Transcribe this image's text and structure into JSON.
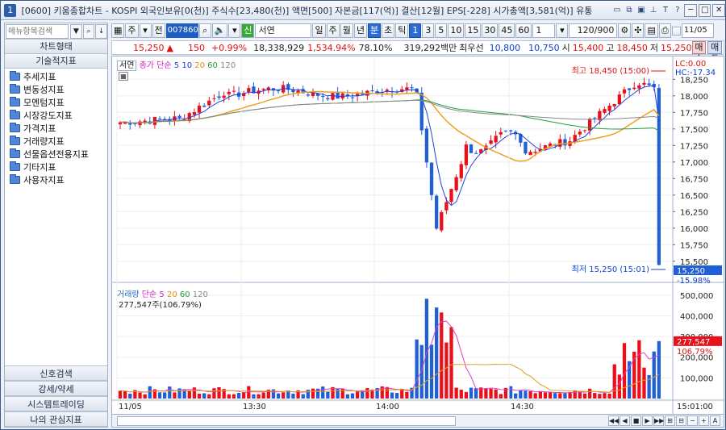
{
  "window": {
    "number": "1",
    "title": "[0600] 키움종합차트 - KOSPI 외국인보유[0(천)] 주식수[23,480(천)] 액면[500] 자본금[117(억)] 결산[12월] EPS[-228] 시가총액[3,581(억)] 유통",
    "tools": [
      "▭",
      "⧉",
      "▣",
      "⊥",
      "T",
      "?"
    ],
    "btn_min": "─",
    "btn_max": "□",
    "btn_close": "✕"
  },
  "left": {
    "search_placeholder": "메뉴항목검색",
    "chart_type_header": "차트형태",
    "tech_header": "기술적지표",
    "items": [
      "추세지표",
      "변동성지표",
      "모멘텀지표",
      "시장강도지표",
      "가격지표",
      "거래량지표",
      "선물옵션전용지표",
      "기타지표",
      "사용자지표"
    ],
    "bottom": [
      "신호검색",
      "강세/약세",
      "시스템트레이딩",
      "나의 관심지표"
    ]
  },
  "toolbar": {
    "market": "주",
    "all": "전",
    "code": "007860",
    "name": "서연",
    "periods": [
      "일",
      "주",
      "월",
      "년",
      "분",
      "초",
      "틱"
    ],
    "minutes": [
      "1",
      "3",
      "5",
      "10",
      "15",
      "30",
      "45",
      "60"
    ],
    "unit": "1",
    "count": "120/900",
    "date": "11/05"
  },
  "quote": {
    "price": "15,250",
    "arrow": "▲",
    "change": "150",
    "rate": "+0.99%",
    "volume": "18,338,929",
    "vol_rate": "1,534.94%",
    "ratio": "78.10%",
    "amount": "319,292백만",
    "pref_label": "최우선",
    "bid1": "10,800",
    "bid2": "10,750",
    "open_label": "시",
    "open": "15,400",
    "high_label": "고",
    "high": "18,450",
    "low_label": "저",
    "low": "15,250",
    "buy": "매수",
    "sell": "매도"
  },
  "chart_data": {
    "type": "candlestick",
    "price_legend": {
      "tab": "서연",
      "label": "종가 단순",
      "periods": [
        "5",
        "10",
        "20",
        "60",
        "120"
      ]
    },
    "volume_legend": {
      "label": "거래량",
      "ma": "단순",
      "periods": [
        "5",
        "20",
        "60",
        "120"
      ],
      "value": "277,547주(106.79%)"
    },
    "price_axis": [
      "18,250",
      "18,000",
      "17,750",
      "17,500",
      "17,250",
      "17,000",
      "16,750",
      "16,500",
      "16,250",
      "16,000",
      "15,750",
      "15,500"
    ],
    "price_ylim": [
      15250,
      18450
    ],
    "volume_axis": [
      "500,000",
      "400,000",
      "300,000",
      "200,000",
      "100,000"
    ],
    "volume_ylim": [
      0,
      550000
    ],
    "x_ticks": [
      "11/05",
      "13:30",
      "14:00",
      "14:30"
    ],
    "last_time": "15:01:00",
    "top_right": [
      "LC:0.00",
      "HC:-17.34"
    ],
    "high_label": "최고 18,450 (15:00)",
    "low_label": "최저 15,250 (15:01)",
    "price_tag": "15,250",
    "price_tag_rate": "-15.98%",
    "volume_tag": "277,547",
    "volume_tag_rate": "106.79%",
    "colors": {
      "up": "#e8101a",
      "down": "#1f5fd8",
      "ma5": "#2040e0",
      "ma10": "#1a3adb",
      "ma20": "#f0a020",
      "ma60": "#20a040",
      "ma120": "#888888",
      "volma5": "#e040c0"
    }
  },
  "scroll": {
    "buttons": [
      "◀◀",
      "◀",
      "■",
      "▶",
      "▶▶",
      "⊞",
      "⊟",
      "−",
      "+",
      "A"
    ]
  }
}
